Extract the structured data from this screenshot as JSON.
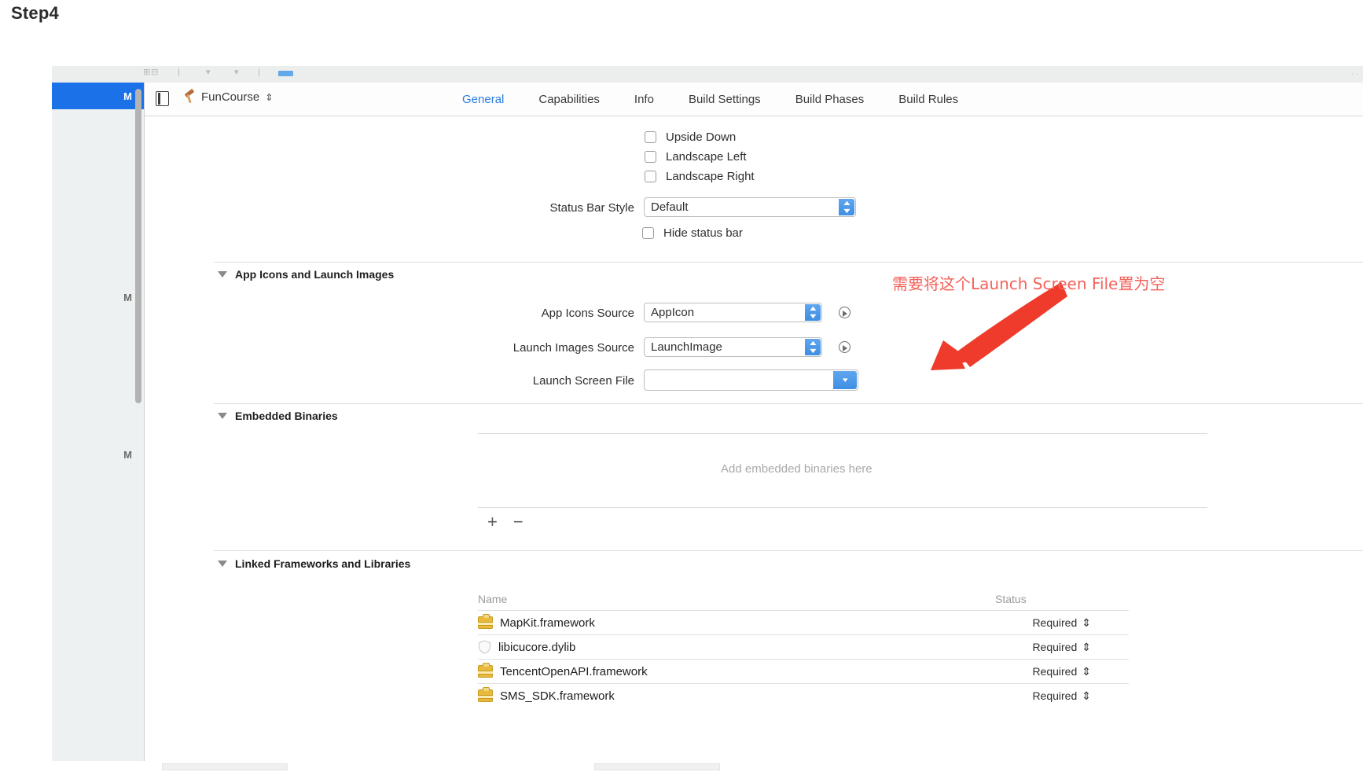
{
  "page": {
    "step_title": "Step4"
  },
  "toolbar": {
    "ghost_items": [
      "⊞⊟",
      "|",
      "▾",
      "▾",
      "|"
    ],
    "right_hint": ". ."
  },
  "navigator": {
    "rows": [
      {
        "badge": "M",
        "selected": true
      },
      {
        "badge": "M",
        "selected": false
      },
      {
        "badge": "M",
        "selected": false
      }
    ]
  },
  "jumpbar": {
    "pane_icon": "left-pane-icon",
    "target_name": "FunCourse",
    "target_chevron": "⇕",
    "tabs": [
      {
        "label": "General",
        "active": true
      },
      {
        "label": "Capabilities",
        "active": false
      },
      {
        "label": "Info",
        "active": false
      },
      {
        "label": "Build Settings",
        "active": false
      },
      {
        "label": "Build Phases",
        "active": false
      },
      {
        "label": "Build Rules",
        "active": false
      }
    ]
  },
  "deployment": {
    "orientation_checkboxes": [
      {
        "label": "Upside Down",
        "checked": false
      },
      {
        "label": "Landscape Left",
        "checked": false
      },
      {
        "label": "Landscape Right",
        "checked": false
      }
    ],
    "status_bar_style": {
      "label": "Status Bar Style",
      "value": "Default"
    },
    "hide_status_bar": {
      "label": "Hide status bar",
      "checked": false
    }
  },
  "app_icons_section": {
    "title": "App Icons and Launch Images",
    "fields": [
      {
        "label": "App Icons Source",
        "value": "AppIcon",
        "has_circle_arrow": true,
        "blue_arrow": false
      },
      {
        "label": "Launch Images Source",
        "value": "LaunchImage",
        "has_circle_arrow": true,
        "blue_arrow": false
      },
      {
        "label": "Launch Screen File",
        "value": "",
        "has_circle_arrow": false,
        "blue_arrow": true
      }
    ]
  },
  "embedded_binaries_section": {
    "title": "Embedded Binaries",
    "empty_placeholder": "Add embedded binaries here",
    "add_button": "+",
    "remove_button": "−"
  },
  "linked_frameworks_section": {
    "title": "Linked Frameworks and Libraries",
    "columns": {
      "name": "Name",
      "status": "Status"
    },
    "rows": [
      {
        "icon": "briefcase-icon",
        "name": "MapKit.framework",
        "status": "Required",
        "stepper": "⇕"
      },
      {
        "icon": "dylib-icon",
        "name": "libicucore.dylib",
        "status": "Required",
        "stepper": "⇕"
      },
      {
        "icon": "briefcase-icon",
        "name": "TencentOpenAPI.framework",
        "status": "Required",
        "stepper": "⇕"
      },
      {
        "icon": "briefcase-icon",
        "name": "SMS_SDK.framework",
        "status": "Required",
        "stepper": "⇕"
      }
    ]
  },
  "annotation": {
    "text": "需要将这个Launch Screen File置为空",
    "color": "#f4625a"
  },
  "colors": {
    "accent_blue": "#1b72e8",
    "tab_active": "#2a7de1",
    "annotation_red": "#f4625a",
    "briefcase_yellow": "#e8b93b"
  }
}
